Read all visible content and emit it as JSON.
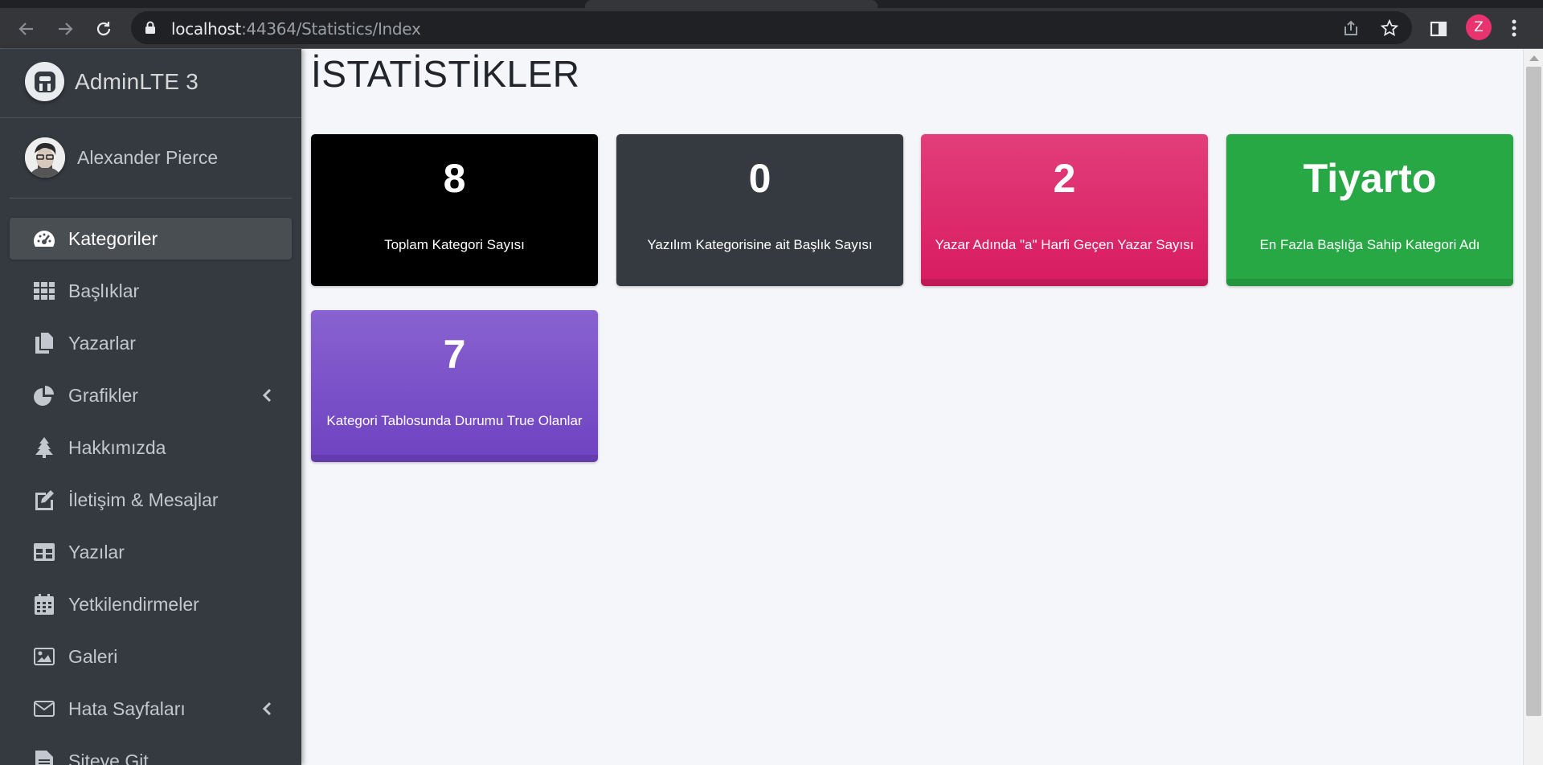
{
  "browser": {
    "url_host": "localhost",
    "url_rest": ":44364/Statistics/Index",
    "profile_initial": "Z",
    "icons": [
      "back-icon",
      "forward-icon",
      "reload-icon",
      "lock-icon",
      "share-icon",
      "star-icon",
      "side-panel-icon",
      "menu-dots-icon"
    ]
  },
  "sidebar": {
    "brand": "AdminLTE 3",
    "user_name": "Alexander Pierce",
    "items": [
      {
        "label": "Kategoriler",
        "icon": "tachometer-icon",
        "active": true
      },
      {
        "label": "Başlıklar",
        "icon": "th-grid-icon"
      },
      {
        "label": "Yazarlar",
        "icon": "copy-icon"
      },
      {
        "label": "Grafikler",
        "icon": "pie-chart-icon",
        "has_arrow": true
      },
      {
        "label": "Hakkımızda",
        "icon": "tree-icon"
      },
      {
        "label": "İletişim & Mesajlar",
        "icon": "edit-icon"
      },
      {
        "label": "Yazılar",
        "icon": "table-icon"
      },
      {
        "label": "Yetkilendirmeler",
        "icon": "calendar-icon"
      },
      {
        "label": "Galeri",
        "icon": "image-icon"
      },
      {
        "label": "Hata Sayfaları",
        "icon": "envelope-icon",
        "has_arrow": true
      },
      {
        "label": "Siteye Git",
        "icon": "file-icon"
      }
    ]
  },
  "main": {
    "title": "İSTATİSTİKLER",
    "cards": [
      {
        "value": "8",
        "caption": "Toplam Kategori Sayısı",
        "color": "#000000"
      },
      {
        "value": "0",
        "caption": "Yazılım Kategorisine ait Başlık Sayısı",
        "color": "#343a40"
      },
      {
        "value": "2",
        "caption": "Yazar Adında \"a\" Harfi Geçen Yazar Sayısı",
        "color": "#d81b60"
      },
      {
        "value": "Tiyarto",
        "caption": "En Fazla Başlığa Sahip Kategori Adı",
        "color": "#28a745"
      },
      {
        "value": "7",
        "caption": "Kategori Tablosunda Durumu True Olanlar",
        "color": "#6f42c1"
      }
    ]
  }
}
